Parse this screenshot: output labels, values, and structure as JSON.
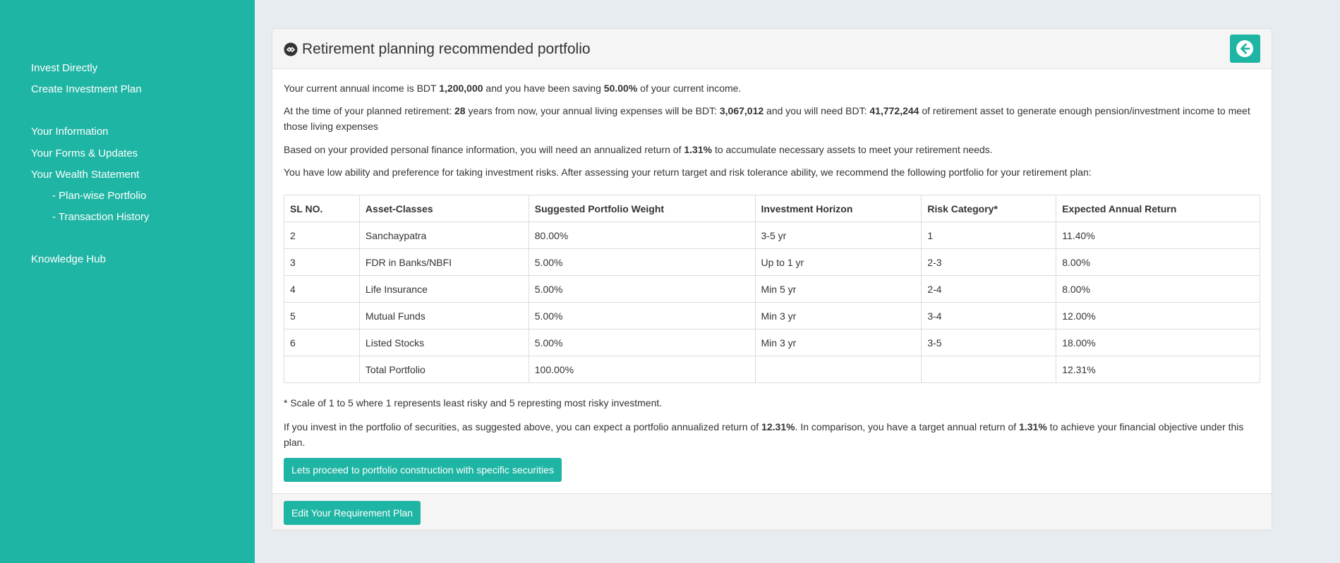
{
  "sidebar": {
    "items": [
      {
        "label": "Invest Directly"
      },
      {
        "label": "Create Investment Plan"
      },
      {
        "label": "Your Information"
      },
      {
        "label": "Your Forms & Updates"
      },
      {
        "label": "Your Wealth Statement"
      },
      {
        "label": "- Plan-wise Portfolio"
      },
      {
        "label": "- Transaction History"
      },
      {
        "label": "Knowledge Hub"
      }
    ]
  },
  "header": {
    "title": "Retirement planning recommended portfolio",
    "icon": "circle-logo-icon",
    "back_icon": "arrow-left-circle-icon"
  },
  "summary": {
    "line1_pre": "Your current annual income is BDT ",
    "income": "1,200,000",
    "line1_mid": " and you have been saving ",
    "saving_pct": "50.00%",
    "line1_post": " of your current income.",
    "line2_pre": "At the time of your planned retirement: ",
    "years": "28",
    "line2_mid1": " years from now, your annual living expenses will be BDT: ",
    "expenses": "3,067,012",
    "line2_mid2": " and you will need BDT: ",
    "asset_needed": "41,772,244",
    "line2_post": " of retirement asset to generate enough pension/investment income to meet those living expenses",
    "line3_pre": "Based on your provided personal finance information, you will need an annualized return of ",
    "required_return": "1.31%",
    "line3_post": " to accumulate necessary assets to meet your retirement needs.",
    "line4": "You have low ability and preference for taking investment risks. After assessing your return target and risk tolerance ability, we recommend the following portfolio for your retirement plan:"
  },
  "table": {
    "headers": [
      "SL NO.",
      "Asset-Classes",
      "Suggested Portfolio Weight",
      "Investment Horizon",
      "Risk Category*",
      "Expected Annual Return"
    ],
    "rows": [
      [
        "2",
        "Sanchaypatra",
        "80.00%",
        "3-5 yr",
        "1",
        "11.40%"
      ],
      [
        "3",
        "FDR in Banks/NBFI",
        "5.00%",
        "Up to 1 yr",
        "2-3",
        "8.00%"
      ],
      [
        "4",
        "Life Insurance",
        "5.00%",
        "Min 5 yr",
        "2-4",
        "8.00%"
      ],
      [
        "5",
        "Mutual Funds",
        "5.00%",
        "Min 3 yr",
        "3-4",
        "12.00%"
      ],
      [
        "6",
        "Listed Stocks",
        "5.00%",
        "Min 3 yr",
        "3-5",
        "18.00%"
      ],
      [
        "",
        "Total Portfolio",
        "100.00%",
        "",
        "",
        "12.31%"
      ]
    ]
  },
  "footnote": "* Scale of 1 to 5 where 1 represents least risky and 5 represting most risky investment.",
  "conclusion": {
    "pre": "If you invest in the portfolio of securities, as suggested above, you can expect a portfolio annualized return of ",
    "portfolio_return": "12.31%",
    "mid": ". In comparison, you have a target annual return of ",
    "target_return": "1.31%",
    "post": " to achieve your financial objective under this plan."
  },
  "buttons": {
    "proceed": "Lets proceed to portfolio construction with specific securities",
    "edit": "Edit Your Requirement Plan"
  },
  "colors": {
    "brand": "#1fb5a4",
    "page_bg": "#e6ecef"
  }
}
